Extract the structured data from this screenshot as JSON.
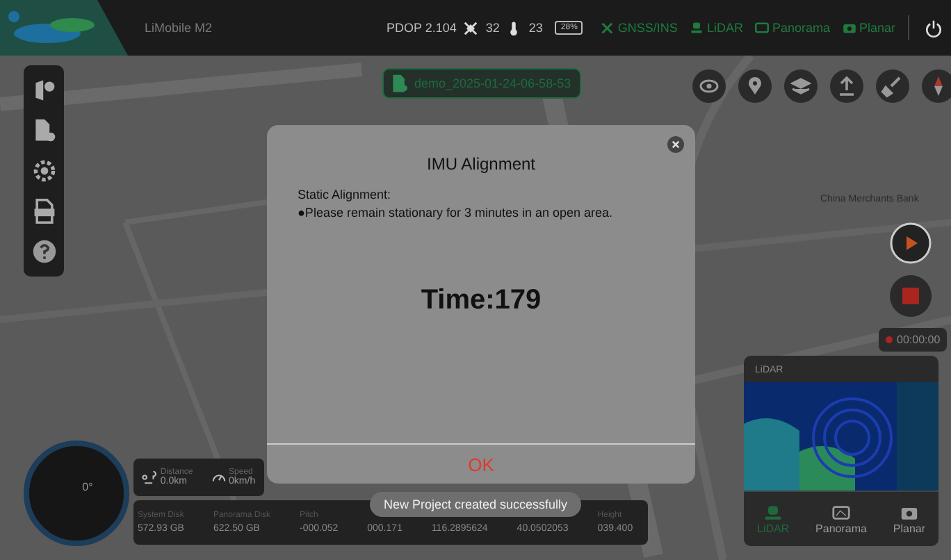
{
  "status_bar": {
    "app_name": "LiMobile M2",
    "pdop": "PDOP 2.104",
    "satellites": "32",
    "temperature": "23",
    "battery": "28%",
    "modules": [
      {
        "kind": "gnss",
        "label": "GNSS/INS",
        "on": true
      },
      {
        "kind": "lidar",
        "label": "LiDAR",
        "on": true
      },
      {
        "kind": "panorama",
        "label": "Panorama",
        "on": true
      },
      {
        "kind": "planar",
        "label": "Planar",
        "on": true
      }
    ]
  },
  "map": {
    "labels": [
      "China Merchants Bank"
    ]
  },
  "project": {
    "name": "demo_2025-01-24-06-58-53"
  },
  "recording": {
    "timer": "00:00:00"
  },
  "lidar_panel": {
    "title": "LiDAR",
    "tabs": [
      {
        "kind": "lidar",
        "label": "LiDAR",
        "selected": true
      },
      {
        "kind": "panorama",
        "label": "Panorama",
        "selected": false
      },
      {
        "kind": "planar",
        "label": "Planar",
        "selected": false
      }
    ]
  },
  "compass": {
    "heading": "0°"
  },
  "motion": [
    {
      "kind": "distance",
      "label": "Distance",
      "value": "0.0km"
    },
    {
      "kind": "speed",
      "label": "Speed",
      "value": "0km/h"
    }
  ],
  "info_bar": [
    {
      "label": "System Disk",
      "value": "572.93 GB"
    },
    {
      "label": "Panorama Disk",
      "value": "622.50 GB"
    },
    {
      "label": "Pitch",
      "value": "-000.052"
    },
    {
      "value": "000.171"
    },
    {
      "value": "116.2895624"
    },
    {
      "value": "40.0502053"
    },
    {
      "label": "Height",
      "value": "039.400"
    }
  ],
  "toast": "New Project created successfully",
  "dialog": {
    "title": "IMU Alignment",
    "section": "Static Alignment:",
    "message": "●Please remain stationary for 3 minutes in an open area.",
    "time": "Time:179",
    "ok": "OK"
  }
}
